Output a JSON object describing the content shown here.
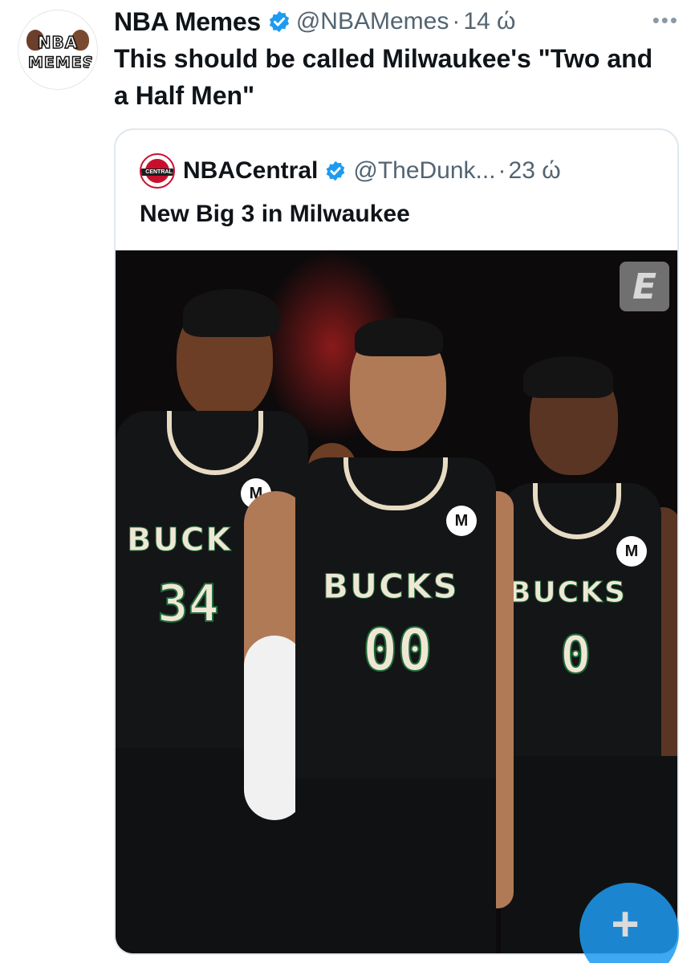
{
  "tweet": {
    "author_name": "NBA Memes",
    "handle": "@NBAMemes",
    "separator": "·",
    "time": "14 ώ",
    "more_icon": "more-horizontal-icon",
    "avatar_text_line1": "NBA",
    "avatar_text_line2": "MEMES",
    "text": "This should be called Milwaukee's \"Two and a Half Men\""
  },
  "quote": {
    "author_name": "NBACentral",
    "handle": "@TheDunk...",
    "separator": "·",
    "time": "23 ώ",
    "avatar_text": "CENTRAL",
    "text": "New Big 3 in Milwaukee",
    "media": {
      "badge": "E",
      "players": [
        {
          "word": "BUCK",
          "number": "34"
        },
        {
          "word": "BUCKS",
          "number": "00"
        },
        {
          "word": "BUCKS",
          "number": "0"
        }
      ]
    }
  },
  "fab": {
    "label": "+",
    "icon": "compose-plus-icon"
  },
  "colors": {
    "verified": "#1d9bf0",
    "muted": "#536471",
    "jersey": "#141517",
    "trim": "#e7dbc3"
  }
}
